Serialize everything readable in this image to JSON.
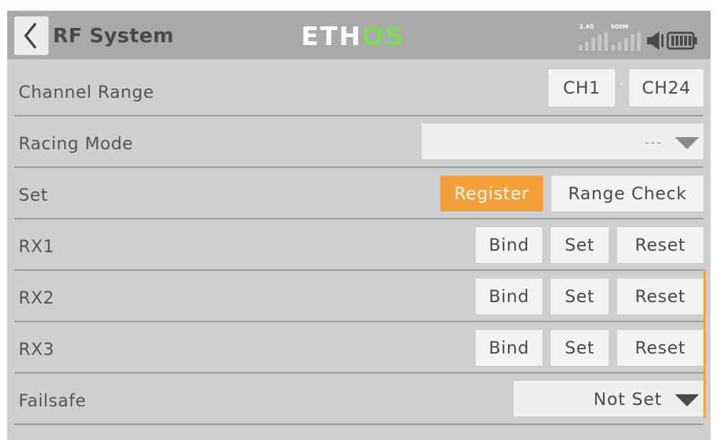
{
  "header": {
    "title": "RF System",
    "logo": {
      "part1": "ETH",
      "part2": "OS"
    },
    "status": {
      "band1_label": "2.4G",
      "band2_label": "900M"
    }
  },
  "rows": [
    {
      "label": "Channel Range",
      "range_start": "CH1",
      "range_sep": "-",
      "range_end": "CH24"
    },
    {
      "label": "Racing Mode",
      "value": "---"
    },
    {
      "label": "Set",
      "register_label": "Register",
      "range_check_label": "Range Check"
    },
    {
      "label": "RX1",
      "bind_label": "Bind",
      "set_label": "Set",
      "reset_label": "Reset"
    },
    {
      "label": "RX2",
      "bind_label": "Bind",
      "set_label": "Set",
      "reset_label": "Reset"
    },
    {
      "label": "RX3",
      "bind_label": "Bind",
      "set_label": "Set",
      "reset_label": "Reset"
    },
    {
      "label": "Failsafe",
      "value": "Not Set"
    }
  ],
  "colors": {
    "accent": "#f6a03a",
    "logo_os": "#7ed957",
    "header_bg": "#a9a9a9",
    "screen_bg": "#cfcfcf"
  },
  "icons": {
    "back": "chevron-left-icon",
    "signal": "signal-bars-icon",
    "speaker": "speaker-icon",
    "battery": "battery-icon"
  }
}
